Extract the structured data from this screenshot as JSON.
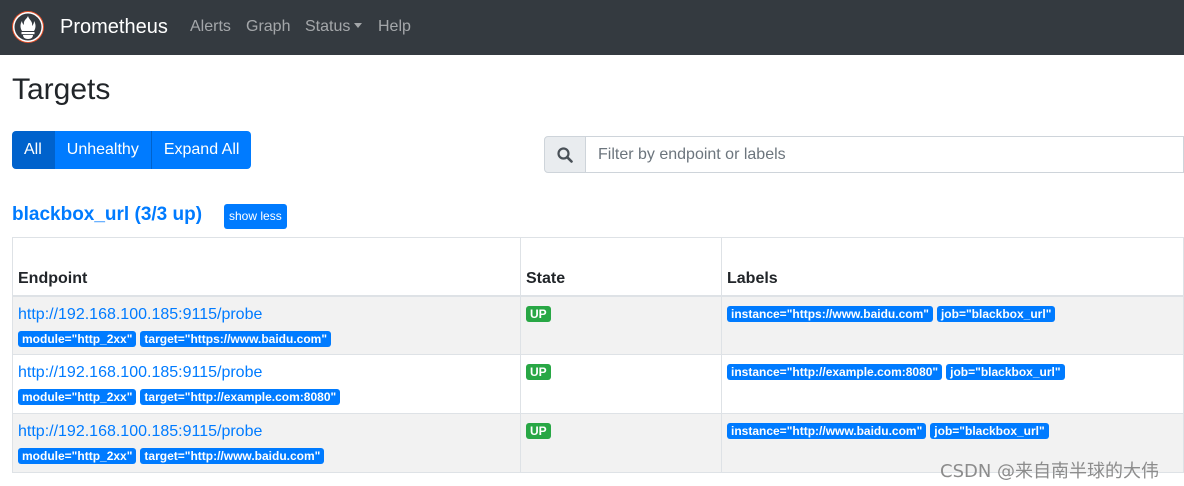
{
  "navbar": {
    "brand": "Prometheus",
    "links": [
      "Alerts",
      "Graph",
      "Status",
      "Help"
    ]
  },
  "page": {
    "title": "Targets"
  },
  "filters": {
    "all": "All",
    "unhealthy": "Unhealthy",
    "expand_all": "Expand All",
    "active": "All"
  },
  "search": {
    "placeholder": "Filter by endpoint or labels"
  },
  "job": {
    "title": "blackbox_url (3/3 up)",
    "toggle_label": "show less",
    "columns": [
      "Endpoint",
      "State",
      "Labels"
    ],
    "rows": [
      {
        "endpoint": "http://192.168.100.185:9115/probe",
        "params": [
          "module=\"http_2xx\"",
          "target=\"https://www.baidu.com\""
        ],
        "state": "UP",
        "labels": [
          "instance=\"https://www.baidu.com\"",
          "job=\"blackbox_url\""
        ]
      },
      {
        "endpoint": "http://192.168.100.185:9115/probe",
        "params": [
          "module=\"http_2xx\"",
          "target=\"http://example.com:8080\""
        ],
        "state": "UP",
        "labels": [
          "instance=\"http://example.com:8080\"",
          "job=\"blackbox_url\""
        ]
      },
      {
        "endpoint": "http://192.168.100.185:9115/probe",
        "params": [
          "module=\"http_2xx\"",
          "target=\"http://www.baidu.com\""
        ],
        "state": "UP",
        "labels": [
          "instance=\"http://www.baidu.com\"",
          "job=\"blackbox_url\""
        ]
      }
    ]
  },
  "watermark": "CSDN @来自南半球的大伟",
  "colors": {
    "navbar_bg": "#343a40",
    "primary": "#007bff",
    "success": "#28a745"
  },
  "icons": {
    "logo": "prometheus-logo-icon",
    "search": "search-icon",
    "status_caret": "caret-down-icon"
  }
}
